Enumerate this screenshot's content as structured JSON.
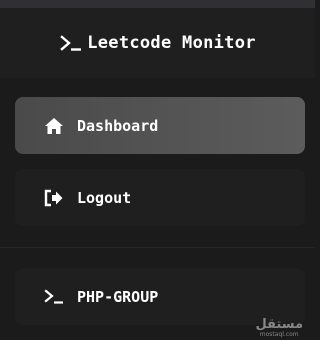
{
  "brand": {
    "title": "Leetcode Monitor",
    "icon": "terminal-prompt-icon"
  },
  "nav": {
    "items": [
      {
        "label": "Dashboard",
        "icon": "home-icon",
        "active": true
      },
      {
        "label": "Logout",
        "icon": "logout-icon",
        "active": false
      }
    ]
  },
  "groups": {
    "items": [
      {
        "label": "PHP-GROUP",
        "icon": "terminal-prompt-icon"
      }
    ]
  },
  "watermark": {
    "main": "مستقل",
    "sub": "mostaql.com"
  },
  "colors": {
    "background": "#1b1b1b",
    "active_item": "#555555",
    "text": "#ffffff"
  }
}
